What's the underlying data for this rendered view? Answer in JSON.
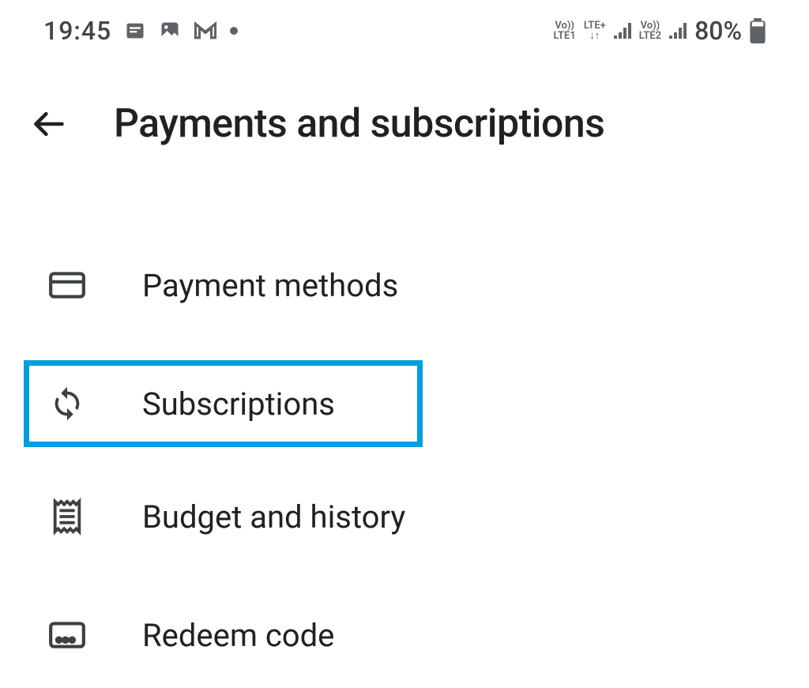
{
  "status_bar": {
    "time": "19:45",
    "battery": "80%",
    "lte1_top": "Vo))",
    "lte1_bottom": "LTE1",
    "lte_plus_top": "LTE+",
    "lte2_top": "Vo))",
    "lte2_bottom": "LTE2"
  },
  "header": {
    "title": "Payments and subscriptions"
  },
  "menu": {
    "items": [
      {
        "label": "Payment methods"
      },
      {
        "label": "Subscriptions"
      },
      {
        "label": "Budget and history"
      },
      {
        "label": "Redeem code"
      }
    ]
  }
}
